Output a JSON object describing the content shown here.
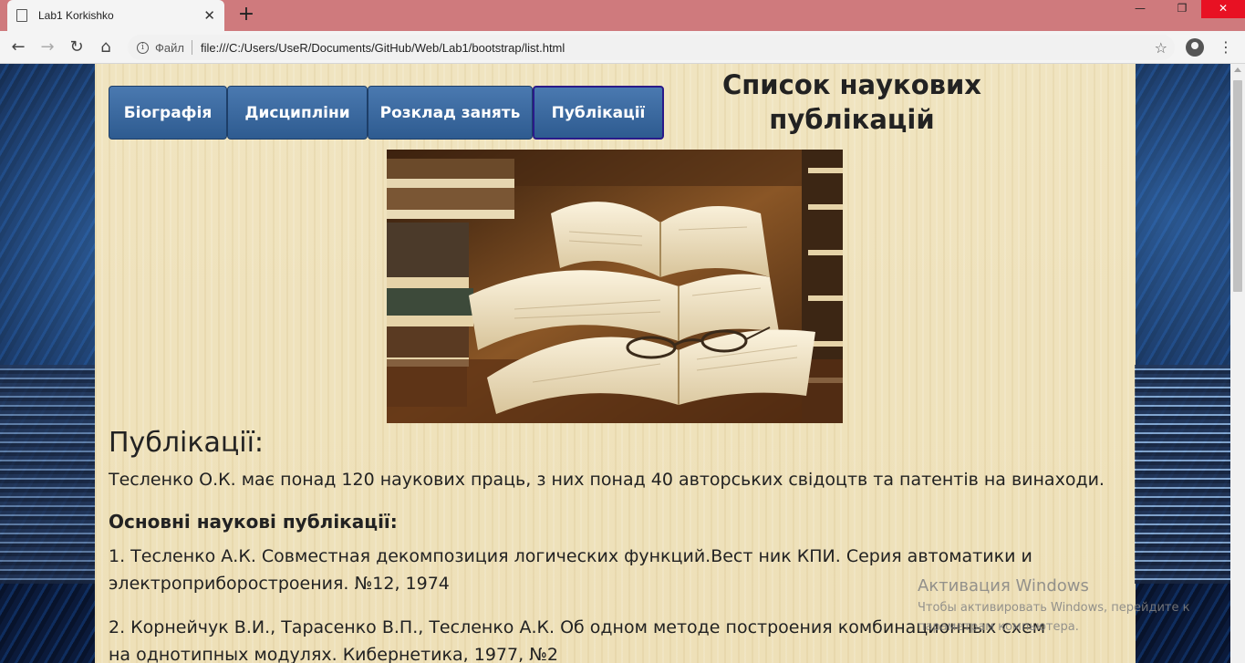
{
  "browser": {
    "tab_title": "Lab1 Korkishko",
    "tab_close": "✕",
    "new_tab": "+",
    "scheme_label": "Файл",
    "url": "file:///C:/Users/UseR/Documents/GitHub/Web/Lab1/bootstrap/list.html",
    "window_controls": {
      "minimize": "—",
      "maximize": "❐",
      "close": "✕"
    }
  },
  "nav": {
    "tabs": [
      {
        "label": "Біографія"
      },
      {
        "label": "Дисципліни"
      },
      {
        "label": "Розклад занять"
      },
      {
        "label": "Публікації"
      }
    ],
    "active_index": 3
  },
  "header": {
    "title_line1": "Список наукових",
    "title_line2": "публікацій"
  },
  "content": {
    "section_title": "Публікації:",
    "lead": "Тесленко О.К. має понад 120 наукових праць, з них понад 40 авторських свідоцтв та патентів на винаходи.",
    "main_title": "Основні наукові публікації:",
    "publications": [
      "1. Тесленко А.К. Совместная декомпозиция логических функций.Вест ник КПИ. Серия автоматики и электроприборостроения. №12, 1974",
      "2. Корнейчук В.И., Тарасенко В.П., Тесленко А.К. Об одном методе построения комбинационных схем на однотипных модулях. Кибернетика, 1977, №2"
    ]
  },
  "watermark": {
    "title": "Активация Windows",
    "subtitle": "Чтобы активировать Windows, перейдите к параметрам компьютера."
  },
  "colors": {
    "titlebar": "#cf7a7d",
    "nav_button": "#3a6aa2",
    "active_border": "#2a1a8a",
    "page_bg": "#efe2bc"
  },
  "icons": [
    "document-icon",
    "back-icon",
    "forward-icon",
    "reload-icon",
    "home-icon",
    "info-icon",
    "star-icon",
    "profile-icon",
    "menu-icon"
  ]
}
